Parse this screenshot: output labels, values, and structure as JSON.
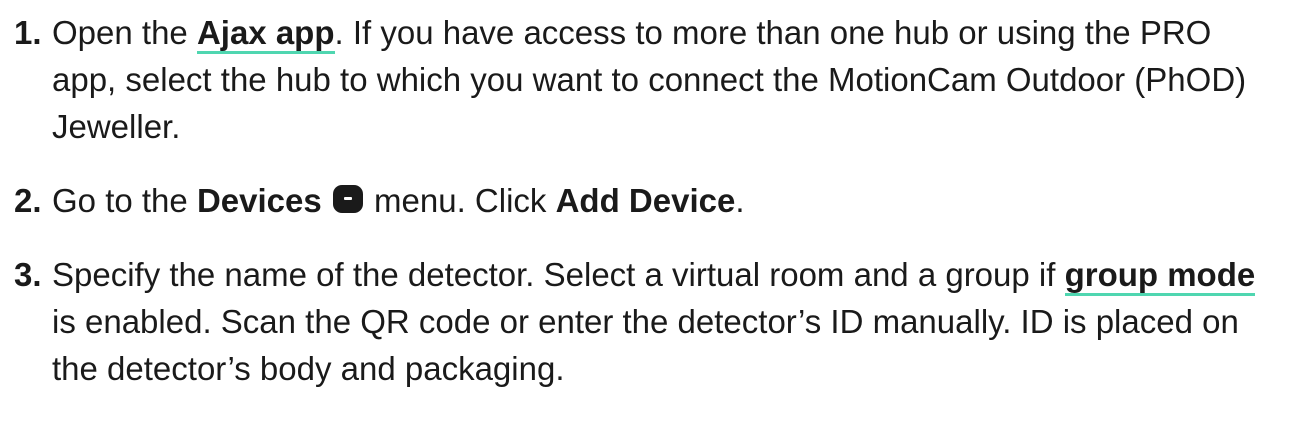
{
  "steps": [
    {
      "number": "1.",
      "t1": "Open the ",
      "link": "Ajax app",
      "t2": ". If you have access to more than one hub or using the PRO app, select the hub to which you want to connect the MotionCam Outdoor (PhOD) Jeweller."
    },
    {
      "number": "2.",
      "t1": "Go to the ",
      "b1": "Devices",
      "icon": "devices-icon",
      "t2": " menu. Click ",
      "b2": "Add Device",
      "t3": "."
    },
    {
      "number": "3.",
      "t1": "Specify the name of the detector. Select a virtual room and a group if ",
      "link": "group mode",
      "t2": " is enabled. Scan the QR code or enter the detector’s ID manually. ID is placed on the detector’s body and packaging."
    }
  ],
  "colors": {
    "text": "#1a1a1a",
    "link_underline": "#4fd6b0"
  }
}
